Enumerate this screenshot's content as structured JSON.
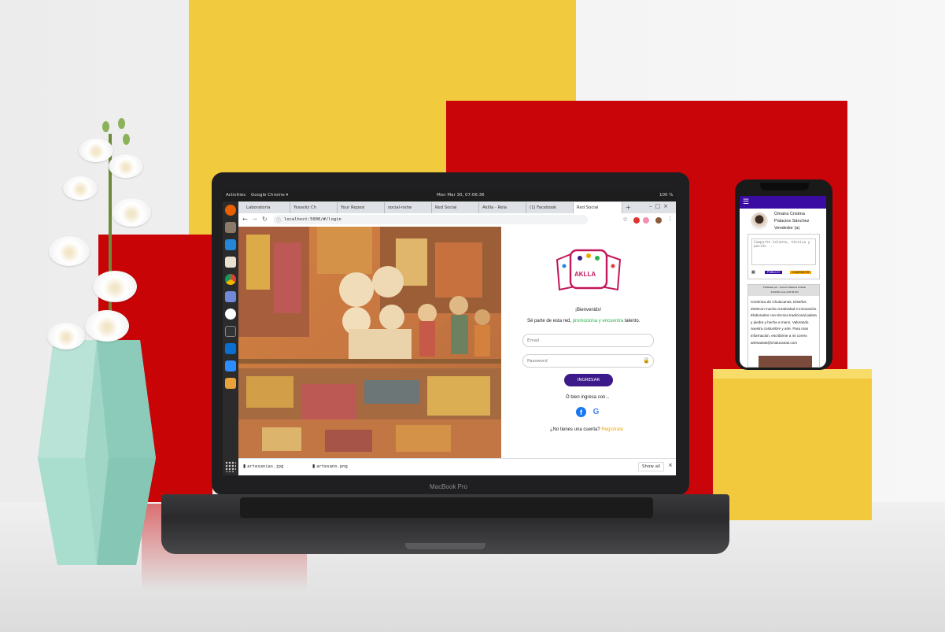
{
  "scene": {
    "laptop_brand": "MacBook Pro"
  },
  "ubuntu_bar": {
    "activities": "Activities",
    "app": "Google Chrome ▾",
    "clock": "Mon Mar 30, 07:06:36",
    "battery": "100 %"
  },
  "browser": {
    "tabs": [
      "Laboratoria",
      "Yesseliz Ch",
      "Your Reposi",
      "social-netw",
      "Red Social",
      "Akllla - Rela",
      "(1) Facebook",
      "Red Social"
    ],
    "url": "localhost:5000/#/login"
  },
  "login": {
    "logo_text": "AKLLA",
    "welcome": "¡Bienvenidx!",
    "tagline_pre": "Sé parte de esta red, ",
    "tagline_highlight": "promociona y encuentra",
    "tagline_post": " talento.",
    "email_placeholder": "Email",
    "password_placeholder": "Password",
    "submit_label": "INGRESAR",
    "alt_login": "Ó bien ingresa con...",
    "signup_prompt": "¿No tienes una cuenta?",
    "signup_link": "Regístrate",
    "accent_color": "#3d1a8a",
    "highlight_color": "#2bb24c",
    "link_color": "#f0a500"
  },
  "downloads": {
    "items": [
      "artesanias.jpg",
      "artesano.png"
    ],
    "show_all": "Show all"
  },
  "phone": {
    "user_name_1": "Omaira Cristina",
    "user_name_2": "Palacios Sánchez",
    "user_role": "Vendedor (a)",
    "composer_placeholder": "Comparte talento, técnica y pasión ...",
    "privacy_label": "PUBLICO",
    "share_label": "COMPARTIR",
    "post_meta_1": "Publicado por : Ovimmi Palacios Cristido",
    "post_meta_2": "3/2/2020 a las 3:28:39 PM",
    "post_body": "Cerámica de Chulucanas, Diseños 2020con mucha creatividad e innovación. Elaborados con técnica tradicional paleta y piedra y hecha a mano. Valorando nuestra costumbre y arte. Para mas información, escribirme a mi correo artesanias@chulucanas.com",
    "header_color": "#3a0ca3"
  }
}
